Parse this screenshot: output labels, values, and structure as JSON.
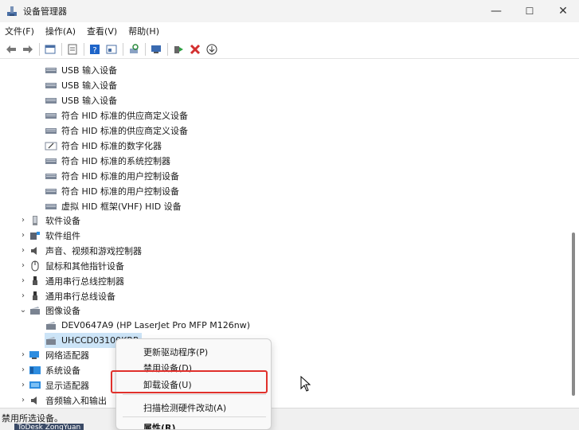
{
  "window": {
    "title": "设备管理器",
    "icon": "device-manager-icon",
    "controls": [
      "—",
      "☐",
      "✕"
    ]
  },
  "menu": [
    "文件(F)",
    "操作(A)",
    "查看(V)",
    "帮助(H)"
  ],
  "toolbar": {
    "icons": [
      "back-icon",
      "forward-icon",
      "show-hide-icon",
      "properties-icon",
      "help-icon",
      "view-icon",
      "scan-hardware-icon",
      "update-driver-icon",
      "enable-icon",
      "uninstall-icon",
      "download-icon"
    ]
  },
  "tree": {
    "hid_children": [
      "USB 输入设备",
      "USB 输入设备",
      "USB 输入设备",
      "符合 HID 标准的供应商定义设备",
      "符合 HID 标准的供应商定义设备",
      "符合 HID 标准的数字化器",
      "符合 HID 标准的系统控制器",
      "符合 HID 标准的用户控制设备",
      "符合 HID 标准的用户控制设备",
      "虚拟 HID 框架(VHF) HID 设备"
    ],
    "categories_before": [
      "软件设备",
      "软件组件",
      "声音、视频和游戏控制器",
      "鼠标和其他指针设备",
      "通用串行总线控制器",
      "通用串行总线设备"
    ],
    "imaging": {
      "label": "图像设备",
      "children": [
        "DEV0647A9 (HP LaserJet Pro MFP M126nw)",
        "UHCCD03100KRP"
      ]
    },
    "categories_after": [
      "网络适配器",
      "系统设备",
      "显示适配器",
      "音频输入和输出"
    ]
  },
  "context_menu": {
    "items": [
      "更新驱动程序(P)",
      "禁用设备(D)",
      "卸载设备(U)",
      "扫描检测硬件改动(A)",
      "属性(R)"
    ],
    "highlighted_index": 2,
    "highlight_color": "#e0302b"
  },
  "status": {
    "text": "禁用所选设备。",
    "taskbar": "ToDesk   ZongYuan"
  },
  "colors": {
    "selection": "#cce4f7",
    "accent_red": "#e0302b"
  }
}
